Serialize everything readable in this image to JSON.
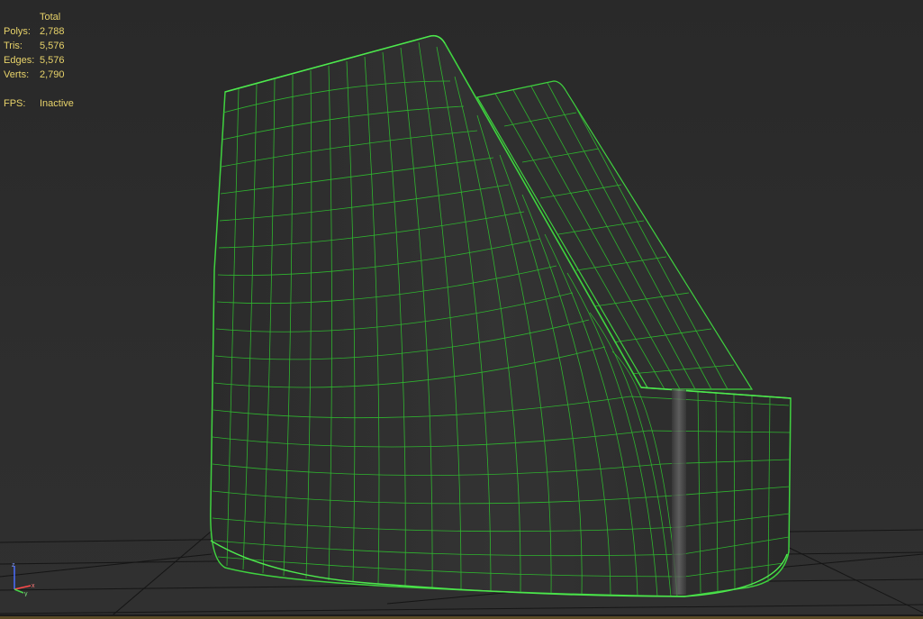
{
  "viewport": {
    "stats": {
      "header": "Total",
      "rows": [
        {
          "label": "Polys:",
          "value": "2,788"
        },
        {
          "label": "Tris:",
          "value": "5,576"
        },
        {
          "label": "Edges:",
          "value": "5,576"
        },
        {
          "label": "Verts:",
          "value": "2,790"
        }
      ],
      "fps": {
        "label": "FPS:",
        "value": "Inactive"
      }
    },
    "gizmo": {
      "z": "z",
      "y": "y",
      "x": "x"
    },
    "colors": {
      "stats_text": "#e8d36a",
      "wireframe": "#3fd23f",
      "grid": "#141414",
      "background": "#2c2c2c"
    }
  }
}
